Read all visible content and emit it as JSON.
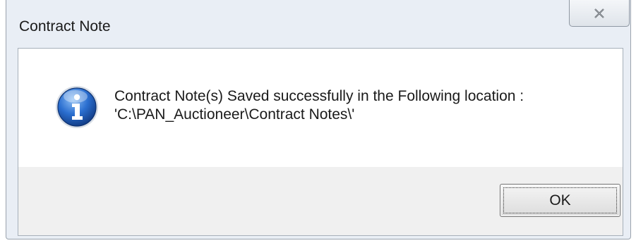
{
  "window": {
    "title": "Contract Note"
  },
  "message": {
    "line1": "Contract Note(s) Saved successfully in the Following location :",
    "line2": "'C:\\PAN_Auctioneer\\Contract Notes\\'"
  },
  "buttons": {
    "ok_label": "OK"
  },
  "icons": {
    "message_icon": "information-icon",
    "close_icon": "close-icon"
  },
  "colors": {
    "info_icon_blue": "#1f5fb5",
    "dialog_frame": "#e9eef5",
    "button_area": "#f0f0f0"
  }
}
